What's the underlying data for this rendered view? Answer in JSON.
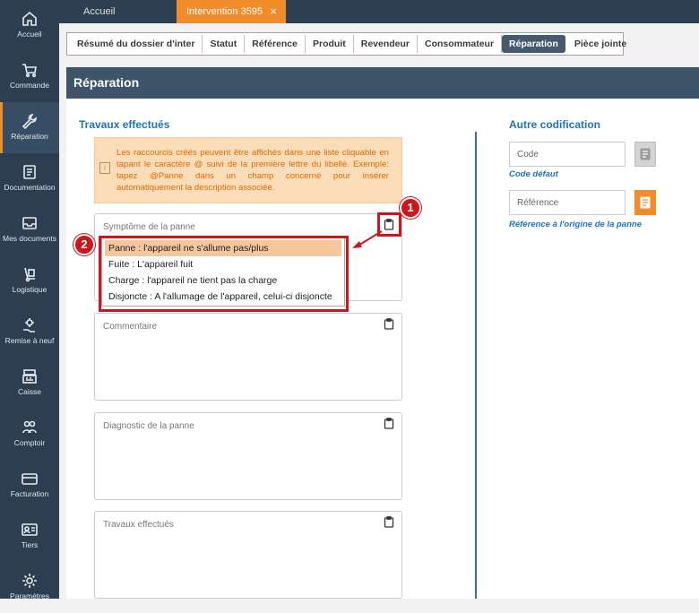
{
  "sidebar": {
    "items": [
      {
        "label": "Accueil",
        "icon": "home-icon"
      },
      {
        "label": "Commande",
        "icon": "cart-icon"
      },
      {
        "label": "Réparation",
        "icon": "wrench-icon"
      },
      {
        "label": "Documentation",
        "icon": "document-icon"
      },
      {
        "label": "Mes documents",
        "icon": "inbox-icon"
      },
      {
        "label": "Logistique",
        "icon": "hand-truck-icon"
      },
      {
        "label": "Remise à neuf",
        "icon": "gear-hand-icon"
      },
      {
        "label": "Caisse",
        "icon": "cash-register-icon"
      },
      {
        "label": "Comptoir",
        "icon": "people-icon"
      },
      {
        "label": "Facturation",
        "icon": "card-icon"
      },
      {
        "label": "Tiers",
        "icon": "contact-card-icon"
      },
      {
        "label": "Paramètres",
        "icon": "settings-icon"
      }
    ]
  },
  "top_tabs": {
    "home": "Accueil",
    "active": "Intervention 3595",
    "close": "×"
  },
  "subtabs": [
    "Résumé du dossier d'inter",
    "Statut",
    "Référence",
    "Produit",
    "Revendeur",
    "Consommateur",
    "Réparation",
    "Pièce jointe"
  ],
  "section_title": "Réparation",
  "left": {
    "heading": "Travaux effectués",
    "info_text": "Les raccourcis créés peuvent être affichés dans une liste cliquable en tapant le caractère @ suivi de la première lettre du libellé. Exemple: tapez @Panne dans un champ concerné pour insérer automatiquement la description associée.",
    "fields": [
      {
        "label": "Symptôme de la panne"
      },
      {
        "label": "Commentaire"
      },
      {
        "label": "Diagnostic de la panne"
      },
      {
        "label": "Travaux effectués"
      }
    ],
    "dropdown": [
      "Panne : l'appareil ne s'allume pas/plus",
      "Fuite : L'appareil fuit",
      "Charge : l'appareil ne tient pas la charge",
      "Disjoncte : A l'allumage de l'appareil, celui-ci disjoncte"
    ]
  },
  "right": {
    "heading": "Autre codification",
    "code_placeholder": "Code",
    "code_link": "Code défaut",
    "ref_placeholder": "Référence",
    "ref_link": "Référence à l'origine de la panne"
  },
  "annotations": {
    "badge1": "1",
    "badge2": "2"
  },
  "colors": {
    "sidebar": "#2c3e50",
    "accent": "#f28c28",
    "header": "#3d5469",
    "link": "#1e73be",
    "annotation": "#d0161d"
  }
}
